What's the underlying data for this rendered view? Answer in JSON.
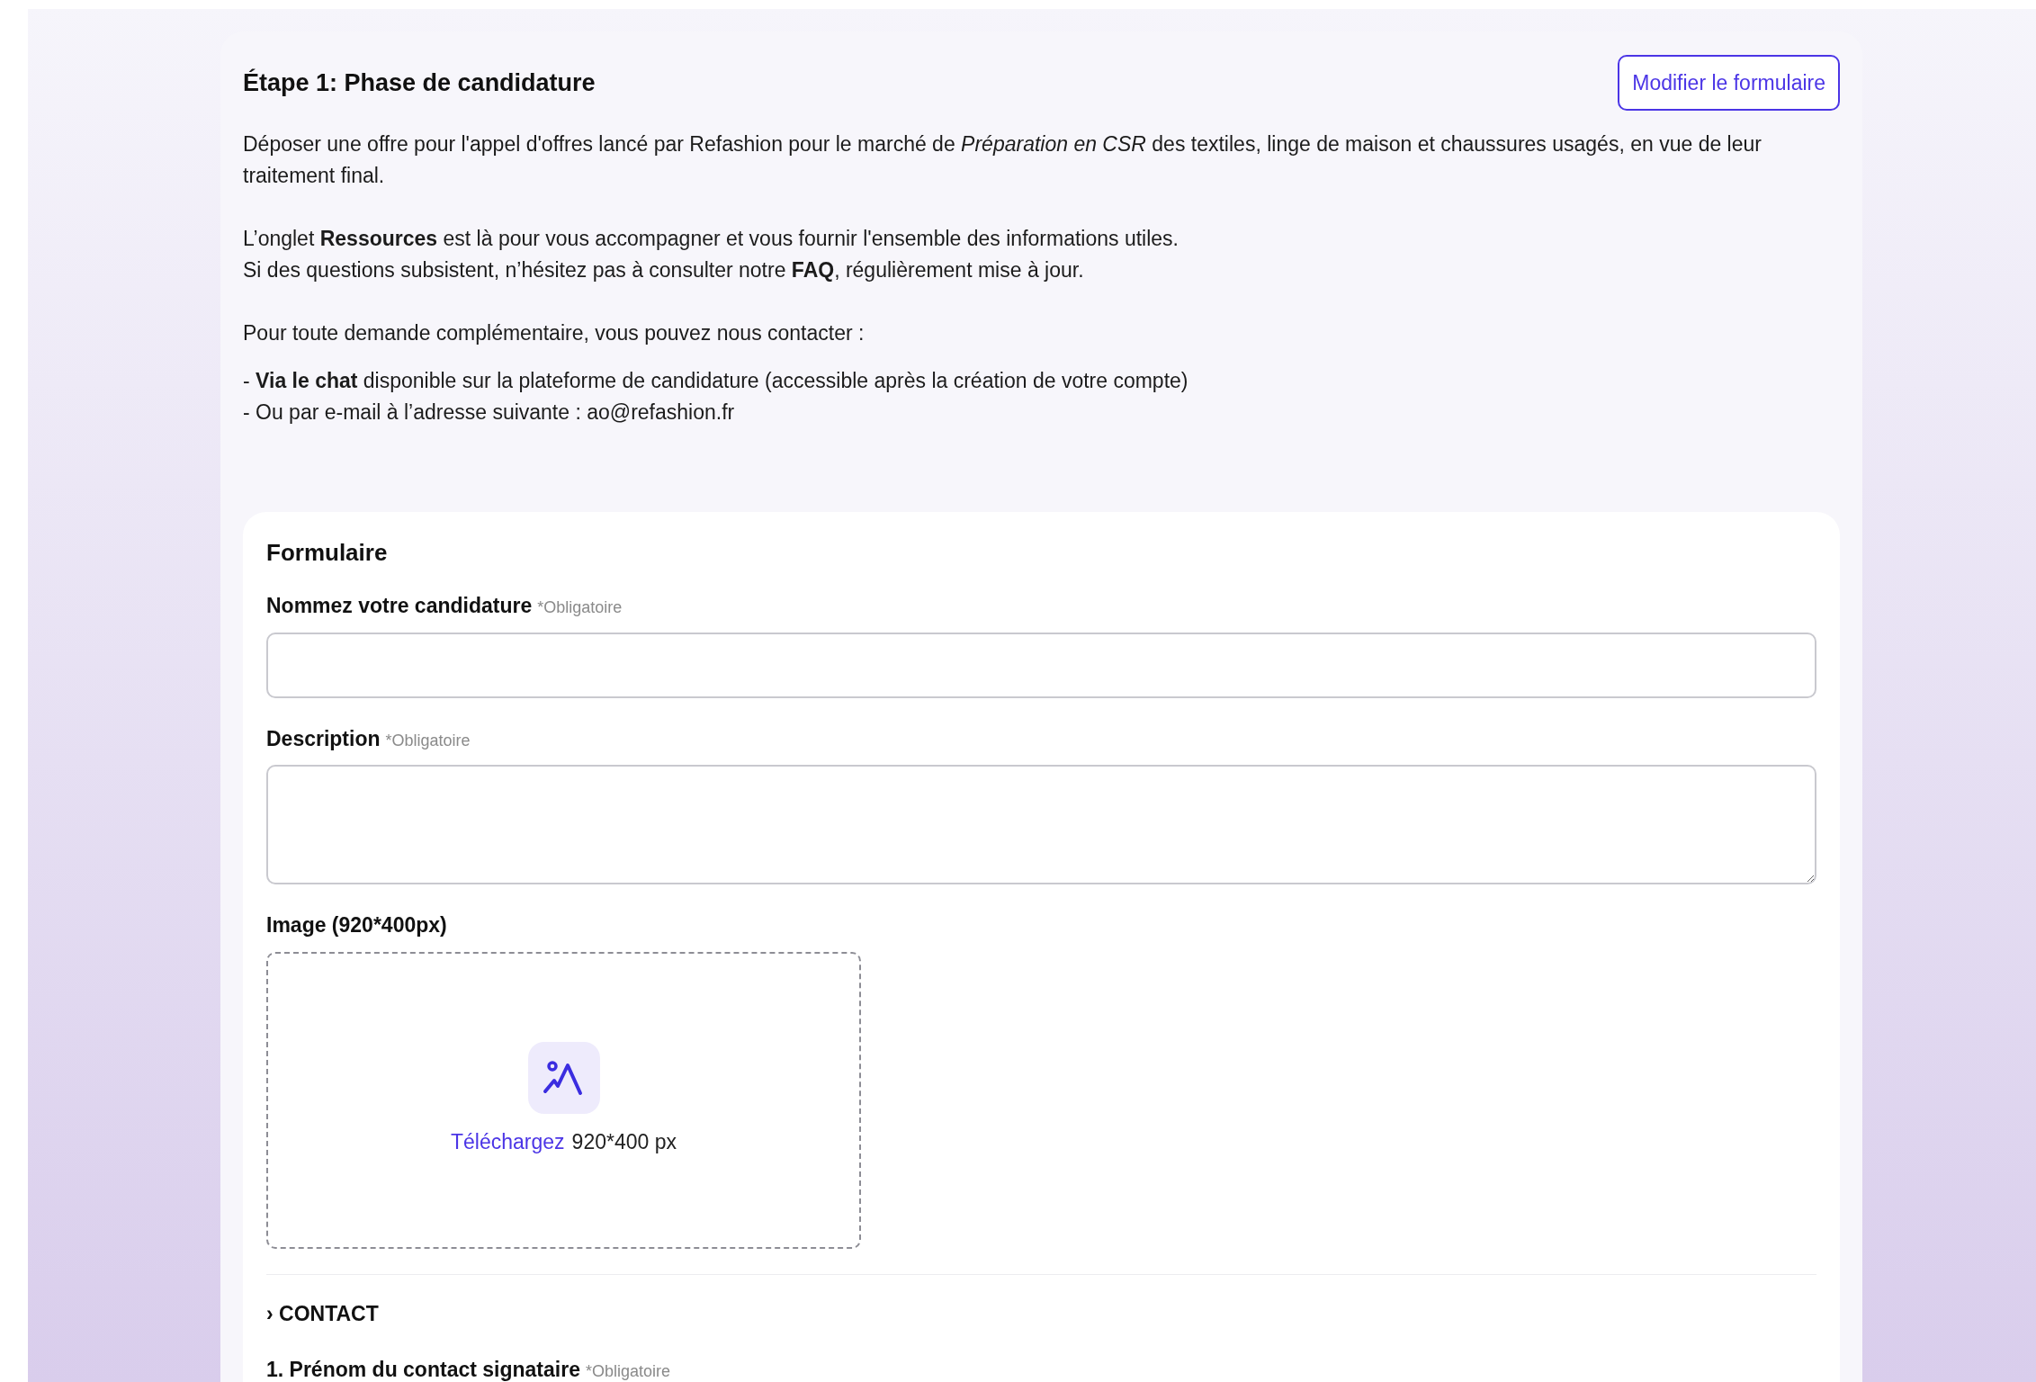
{
  "step": {
    "title": "Étape 1: Phase de candidature",
    "edit_button": "Modifier le formulaire",
    "paragraphs": [
      [
        "Déposer une offre pour l'appel d'offres lancé par Refashion pour le marché de *Préparation en CSR* des textiles, linge de maison et chaussures usagés, en vue de leur traitement final."
      ],
      [
        "L’onglet **Ressources** est là pour vous accompagner et vous fournir l'ensemble des informations utiles.",
        "Si des questions subsistent, n’hésitez pas à consulter notre **FAQ**, régulièrement mise à jour."
      ],
      [
        "Pour toute demande complémentaire, vous pouvez nous contacter :"
      ],
      [
        "- **Via le chat** disponible sur la plateforme de candidature (accessible après la création de votre compte)",
        "- Ou par e-mail à l’adresse suivante : ao@refashion.fr"
      ]
    ]
  },
  "form": {
    "title": "Formulaire",
    "fields": [
      {
        "kind": "input",
        "label": "Nommez votre candidature",
        "required": "*Obligatoire"
      },
      {
        "kind": "textarea",
        "label": "Description",
        "required": "*Obligatoire"
      },
      {
        "kind": "image",
        "label": "Image (920*400px)",
        "upload_link": "Téléchargez",
        "upload_hint": "920*400 px"
      }
    ],
    "section": {
      "chevron": "›",
      "title": "CONTACT"
    },
    "section_fields": [
      {
        "label": "1. Prénom du contact signataire",
        "required": "*Obligatoire"
      }
    ]
  }
}
